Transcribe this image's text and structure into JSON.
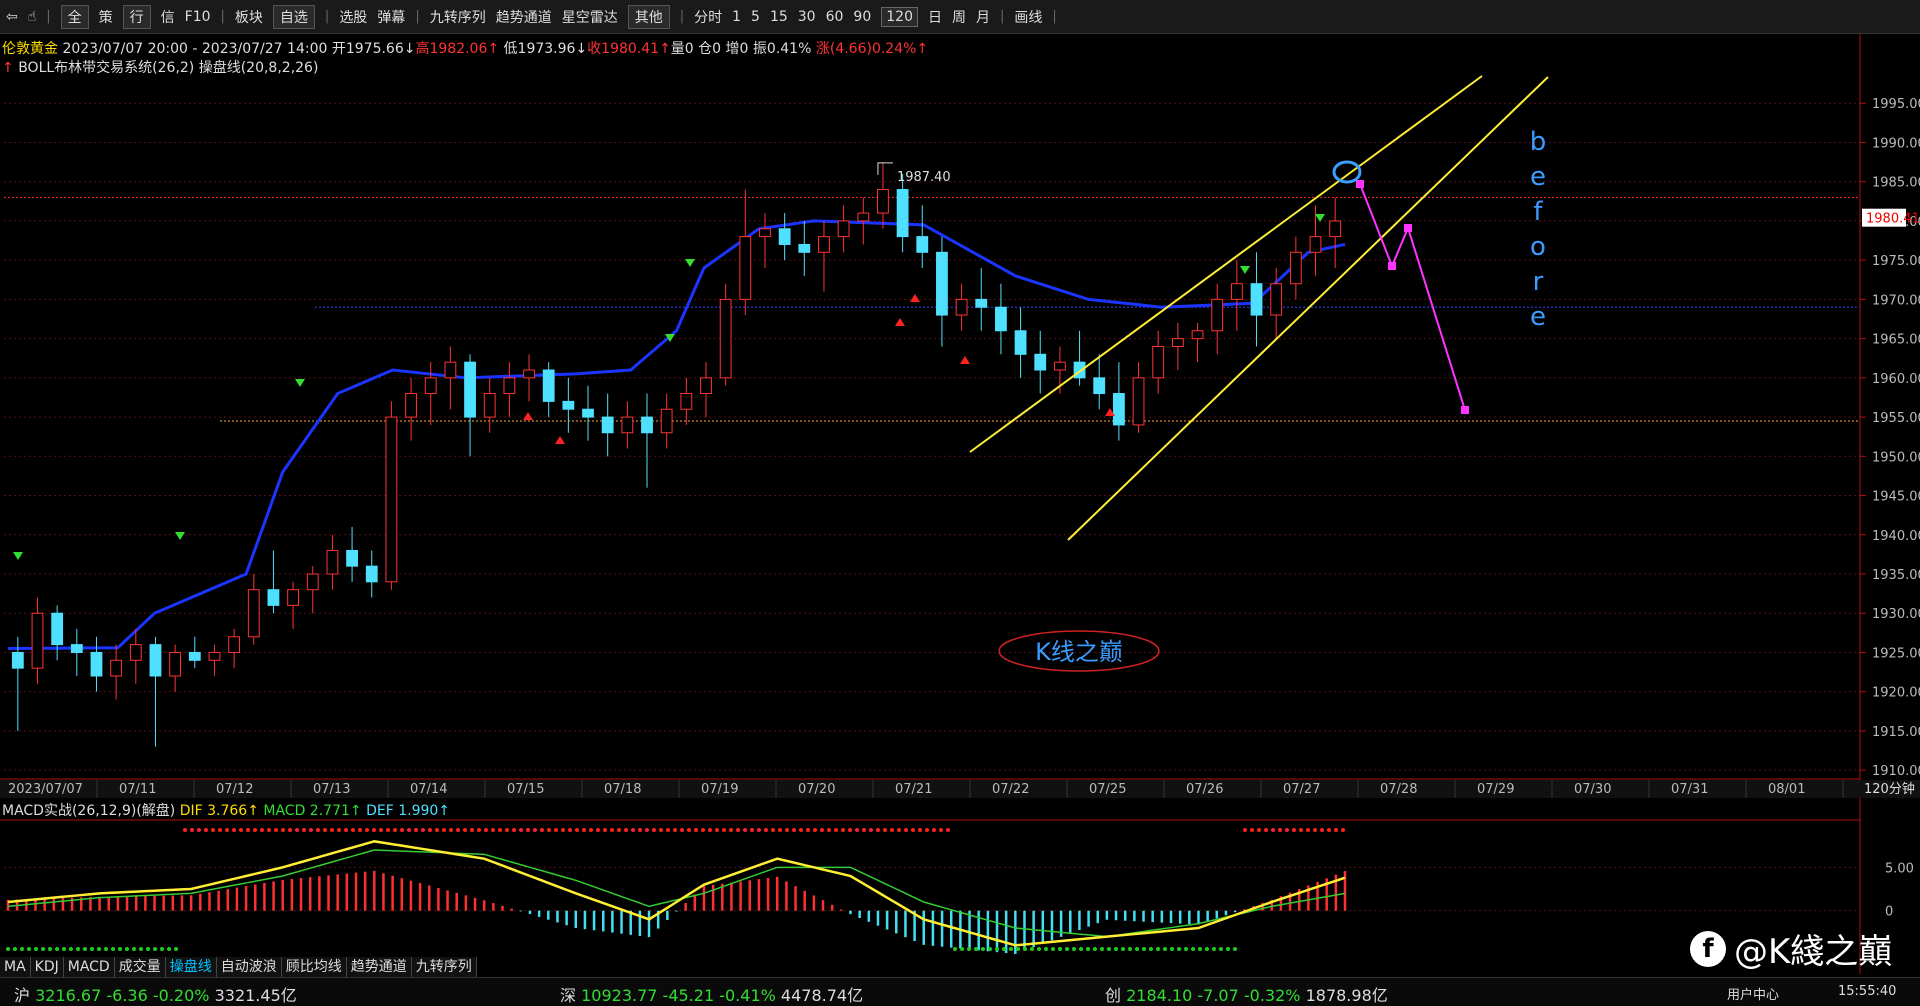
{
  "toolbar": {
    "items": [
      "全",
      "策",
      "行",
      "信",
      "F10",
      "板块",
      "自选",
      "选股",
      "弹幕",
      "九转序列",
      "趋势通道",
      "星空雷达",
      "其他",
      "分时",
      "1",
      "5",
      "15",
      "30",
      "60",
      "90",
      "120",
      "日",
      "周",
      "月",
      "画线"
    ]
  },
  "info": {
    "name": "伦敦黄金",
    "range": "2023/07/07 20:00 - 2023/07/27 14:00",
    "open": "开1975.66↓",
    "high": "高1982.06↑",
    "low": "低1973.96↓",
    "close": "收1980.41↑",
    "vol": "量0",
    "pos": "仓0",
    "inc": "增0",
    "amp": "振0.41%",
    "chg": "涨(4.66)0.24%↑"
  },
  "indicator": {
    "text": "BOLL布林带交易系统(26,2)  操盘线(20,8,2,26)"
  },
  "macd_header": {
    "name": "MACD实战(26,12,9)(解盘)",
    "dif": "DIF 3.766↑",
    "macd": "MACD 2.771↑",
    "dea": "DEF 1.990↑"
  },
  "tabs": [
    "MA",
    "KDJ",
    "MACD",
    "成交量",
    "操盘线",
    "自动波浪",
    "顾比均线",
    "趋势通道",
    "九转序列"
  ],
  "status": {
    "sh": {
      "name": "沪",
      "price": "3216.67",
      "chg": "-6.36",
      "pct": "-0.20%",
      "amt": "3321.45亿"
    },
    "sz": {
      "name": "深",
      "price": "10923.77",
      "chg": "-45.21",
      "pct": "-0.41%",
      "amt": "4478.74亿"
    },
    "cy": {
      "name": "创",
      "price": "2184.10",
      "chg": "-7.07",
      "pct": "-0.32%",
      "amt": "1878.98亿"
    },
    "user": "用户中心",
    "time": "15:55:40"
  },
  "watermark": "@K綫之巔",
  "watermark_icon": "facebook-icon",
  "colors": {
    "up": "#ff3333",
    "down": "#4fe0ff",
    "boll_mid": "#1c34ff",
    "channel": "#ffee33",
    "projection": "#ff33ff",
    "dif": "#ffee33",
    "dea": "#33cc33"
  },
  "chart_data": {
    "type": "candlestick",
    "timeframe": "120分钟",
    "y_ticks": [
      1995.0,
      1990.0,
      1985.0,
      1980.0,
      1975.0,
      1970.0,
      1965.0,
      1960.0,
      1955.0,
      1950.0,
      1945.0,
      1940.0,
      1935.0,
      1930.0,
      1925.0,
      1920.0,
      1915.0,
      1910.0
    ],
    "ylim": [
      1909,
      2000
    ],
    "x_labels": [
      "2023/07/07",
      "07/11",
      "07/12",
      "07/13",
      "07/14",
      "07/15",
      "07/18",
      "07/19",
      "07/20",
      "07/21",
      "07/22",
      "07/25",
      "07/26",
      "07/27",
      "07/28",
      "07/29",
      "07/30",
      "07/31",
      "08/01"
    ],
    "last_price": "1980.41",
    "high_label": "1987.40",
    "high_value": 1987.4,
    "annotation_text": "before",
    "logo_text": "K线之巅",
    "candles": [
      [
        1925,
        1927,
        1915,
        1923
      ],
      [
        1923,
        1932,
        1921,
        1930
      ],
      [
        1930,
        1931,
        1924,
        1926
      ],
      [
        1926,
        1928,
        1922,
        1925
      ],
      [
        1925,
        1927,
        1920,
        1922
      ],
      [
        1922,
        1926,
        1919,
        1924
      ],
      [
        1924,
        1928,
        1921,
        1926
      ],
      [
        1926,
        1927,
        1913,
        1922
      ],
      [
        1922,
        1926,
        1920,
        1925
      ],
      [
        1925,
        1927,
        1923,
        1924
      ],
      [
        1924,
        1926,
        1922,
        1925
      ],
      [
        1925,
        1928,
        1923,
        1927
      ],
      [
        1927,
        1935,
        1926,
        1933
      ],
      [
        1933,
        1938,
        1930,
        1931
      ],
      [
        1931,
        1934,
        1928,
        1933
      ],
      [
        1933,
        1936,
        1930,
        1935
      ],
      [
        1935,
        1940,
        1933,
        1938
      ],
      [
        1938,
        1941,
        1934,
        1936
      ],
      [
        1936,
        1938,
        1932,
        1934
      ],
      [
        1934,
        1957,
        1933,
        1955
      ],
      [
        1955,
        1960,
        1952,
        1958
      ],
      [
        1958,
        1962,
        1954,
        1960
      ],
      [
        1960,
        1964,
        1956,
        1962
      ],
      [
        1962,
        1963,
        1950,
        1955
      ],
      [
        1955,
        1960,
        1953,
        1958
      ],
      [
        1958,
        1962,
        1955,
        1960
      ],
      [
        1960,
        1963,
        1957,
        1961
      ],
      [
        1961,
        1962,
        1955,
        1957
      ],
      [
        1957,
        1960,
        1953,
        1956
      ],
      [
        1956,
        1959,
        1952,
        1955
      ],
      [
        1955,
        1958,
        1950,
        1953
      ],
      [
        1953,
        1957,
        1951,
        1955
      ],
      [
        1955,
        1958,
        1946,
        1953
      ],
      [
        1953,
        1958,
        1951,
        1956
      ],
      [
        1956,
        1960,
        1954,
        1958
      ],
      [
        1958,
        1962,
        1955,
        1960
      ],
      [
        1960,
        1972,
        1959,
        1970
      ],
      [
        1970,
        1984,
        1968,
        1978
      ],
      [
        1978,
        1981,
        1974,
        1979
      ],
      [
        1979,
        1981,
        1975,
        1977
      ],
      [
        1977,
        1980,
        1973,
        1976
      ],
      [
        1976,
        1980,
        1971,
        1978
      ],
      [
        1978,
        1982,
        1976,
        1980
      ],
      [
        1980,
        1983,
        1977,
        1981
      ],
      [
        1981,
        1987.4,
        1979,
        1984
      ],
      [
        1984,
        1986,
        1976,
        1978
      ],
      [
        1978,
        1982,
        1974,
        1976
      ],
      [
        1976,
        1978,
        1964,
        1968
      ],
      [
        1968,
        1972,
        1966,
        1970
      ],
      [
        1970,
        1974,
        1966,
        1969
      ],
      [
        1969,
        1972,
        1963,
        1966
      ],
      [
        1966,
        1969,
        1960,
        1963
      ],
      [
        1963,
        1966,
        1958,
        1961
      ],
      [
        1961,
        1964,
        1958,
        1962
      ],
      [
        1962,
        1966,
        1959,
        1960
      ],
      [
        1960,
        1963,
        1956,
        1958
      ],
      [
        1958,
        1962,
        1952,
        1954
      ],
      [
        1954,
        1962,
        1953,
        1960
      ],
      [
        1960,
        1966,
        1958,
        1964
      ],
      [
        1964,
        1967,
        1961,
        1965
      ],
      [
        1965,
        1967,
        1962,
        1966
      ],
      [
        1966,
        1972,
        1963,
        1970
      ],
      [
        1970,
        1975,
        1966,
        1972
      ],
      [
        1972,
        1976,
        1964,
        1968
      ],
      [
        1968,
        1974,
        1965,
        1972
      ],
      [
        1972,
        1978,
        1970,
        1976
      ],
      [
        1976,
        1982,
        1973,
        1978
      ],
      [
        1978,
        1983,
        1974,
        1980
      ]
    ],
    "boll_mid": [
      [
        0,
        1925.5
      ],
      [
        12,
        1925.6
      ],
      [
        16,
        1930
      ],
      [
        22,
        1933
      ],
      [
        26,
        1935
      ],
      [
        30,
        1948
      ],
      [
        36,
        1958
      ],
      [
        42,
        1961
      ],
      [
        50,
        1960
      ],
      [
        62,
        1960.5
      ],
      [
        68,
        1961
      ],
      [
        73,
        1966
      ],
      [
        76,
        1974
      ],
      [
        82,
        1979
      ],
      [
        88,
        1980
      ],
      [
        100,
        1979.5
      ],
      [
        110,
        1973
      ],
      [
        118,
        1970
      ],
      [
        126,
        1969
      ],
      [
        136,
        1969.5
      ],
      [
        142,
        1976
      ],
      [
        146,
        1977
      ]
    ],
    "macd": {
      "ylim": [
        -5,
        10
      ],
      "y_ticks": [
        5.0,
        0
      ],
      "dif": [
        [
          0,
          1
        ],
        [
          10,
          2
        ],
        [
          20,
          2.5
        ],
        [
          30,
          5
        ],
        [
          40,
          8
        ],
        [
          52,
          6
        ],
        [
          62,
          2
        ],
        [
          70,
          -1
        ],
        [
          76,
          3
        ],
        [
          84,
          6
        ],
        [
          92,
          4
        ],
        [
          100,
          -1
        ],
        [
          110,
          -4
        ],
        [
          120,
          -3
        ],
        [
          130,
          -2
        ],
        [
          138,
          1
        ],
        [
          146,
          3.8
        ]
      ],
      "dea": [
        [
          0,
          0.5
        ],
        [
          10,
          1.5
        ],
        [
          20,
          2
        ],
        [
          30,
          4
        ],
        [
          40,
          7
        ],
        [
          52,
          6.5
        ],
        [
          62,
          3.5
        ],
        [
          70,
          0.5
        ],
        [
          76,
          2
        ],
        [
          84,
          5
        ],
        [
          92,
          5
        ],
        [
          100,
          1
        ],
        [
          110,
          -2
        ],
        [
          120,
          -3
        ],
        [
          130,
          -1.5
        ],
        [
          138,
          0.5
        ],
        [
          146,
          2
        ]
      ]
    }
  }
}
